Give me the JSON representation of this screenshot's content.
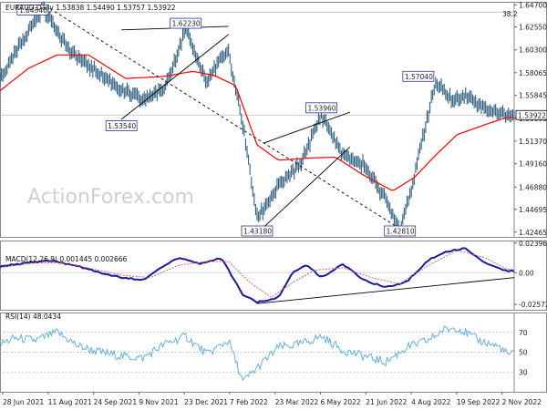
{
  "header": {
    "main": "EURAUD,Daily 1.53838 1.54490 1.53757 1.53922",
    "macd": "MACD(12,26,9) 0.001445 0.002666",
    "rsi": "RSI(14) 48.0434"
  },
  "watermark": "ActionForex.com",
  "fib_label": "38.2",
  "colors": {
    "price": "#2f5f80",
    "ma": "#ff0000",
    "macd": "#1a1a9a",
    "signal": "#e05050",
    "rsi": "#55aadd",
    "label_border": "#2b3a8f",
    "trendline": "#000000"
  },
  "chart_data": [
    {
      "type": "line",
      "title": "EURAUD,Daily",
      "ohlc_last": {
        "open": 1.53838,
        "high": 1.5449,
        "low": 1.53757,
        "close": 1.53922
      },
      "last_price_tag": "1.53922",
      "y_ticks": [
        "1.64700",
        "1.62550",
        "1.60300",
        "1.58065",
        "1.55845",
        "1.53595",
        "1.51370",
        "1.49160",
        "1.46880",
        "1.44695",
        "1.42465"
      ],
      "ylim": [
        1.42,
        1.65
      ],
      "x_ticks": [
        "28 Jun 2021",
        "11 Aug 2021",
        "24 Sep 2021",
        "9 Nov 2021",
        "23 Dec 2021",
        "7 Feb 2022",
        "23 Mar 2022",
        "6 May 2022",
        "21 Jun 2022",
        "4 Aug 2022",
        "19 Sep 2022",
        "2 Nov 2022"
      ],
      "x_domain": [
        0,
        360
      ],
      "series": [
        {
          "style": "close",
          "x": [
            0,
            10,
            20,
            30,
            40,
            50,
            62,
            75,
            88,
            100,
            115,
            130,
            145,
            152,
            160,
            170,
            180,
            195,
            210,
            225,
            240,
            255,
            268,
            280,
            290,
            298,
            305,
            318,
            325,
            340,
            355
          ],
          "y": [
            1.575,
            1.597,
            1.622,
            1.6434,
            1.622,
            1.6,
            1.588,
            1.575,
            1.561,
            1.554,
            1.565,
            1.6223,
            1.57,
            1.59,
            1.6,
            1.53,
            1.438,
            1.47,
            1.49,
            1.5396,
            1.5,
            1.49,
            1.462,
            1.4281,
            1.478,
            1.53,
            1.5704,
            1.552,
            1.559,
            1.545,
            1.53922
          ]
        },
        {
          "style": "moving-average",
          "x": [
            0,
            20,
            40,
            62,
            88,
            115,
            135,
            150,
            165,
            180,
            195,
            215,
            235,
            255,
            275,
            290,
            305,
            320,
            340,
            355
          ],
          "y": [
            1.563,
            1.585,
            1.598,
            1.598,
            1.575,
            1.577,
            1.582,
            1.578,
            1.568,
            1.51,
            1.495,
            1.497,
            1.498,
            1.48,
            1.465,
            1.478,
            1.5,
            1.52,
            1.53,
            1.537
          ]
        }
      ],
      "annotations": [
        {
          "text": "1.64340",
          "x": 35,
          "y": 1.6434
        },
        {
          "text": "1.62230",
          "x": 130,
          "y": 1.6223
        },
        {
          "text": "1.53540",
          "x": 85,
          "y": 1.5354
        },
        {
          "text": "1.43180",
          "x": 180,
          "y": 1.4318
        },
        {
          "text": "1.53960",
          "x": 225,
          "y": 1.5396
        },
        {
          "text": "1.42810",
          "x": 280,
          "y": 1.4281
        },
        {
          "text": "1.57040",
          "x": 305,
          "y": 1.5704
        }
      ],
      "trendlines": [
        {
          "style": "dashed",
          "x": [
            35,
            280
          ],
          "y": [
            1.6434,
            1.4281
          ]
        },
        {
          "style": "solid",
          "x": [
            85,
            160
          ],
          "y": [
            1.535,
            1.618
          ]
        },
        {
          "style": "solid",
          "x": [
            85,
            160
          ],
          "y": [
            1.6225,
            1.626
          ]
        },
        {
          "style": "solid",
          "x": [
            185,
            245
          ],
          "y": [
            1.43,
            1.508
          ]
        },
        {
          "style": "solid",
          "x": [
            185,
            245
          ],
          "y": [
            1.512,
            1.542
          ]
        },
        {
          "style": "fib",
          "x": [
            0,
            360
          ],
          "y": [
            1.64,
            1.64
          ]
        }
      ]
    },
    {
      "type": "line",
      "title": "MACD(12,26,9)",
      "values_label": [
        "0.001445",
        "0.002666"
      ],
      "y_ticks": [
        "0.023963",
        "0.00",
        "-0.025726"
      ],
      "ylim": [
        -0.03,
        0.026
      ],
      "series": [
        {
          "style": "macd",
          "x": [
            0,
            20,
            35,
            55,
            70,
            85,
            100,
            112,
            125,
            140,
            155,
            170,
            180,
            195,
            205,
            215,
            225,
            240,
            255,
            270,
            285,
            300,
            310,
            325,
            340,
            355
          ],
          "y": [
            0.005,
            0.008,
            0.01,
            0.005,
            0.0,
            -0.004,
            -0.006,
            0.004,
            0.012,
            0.007,
            0.012,
            -0.018,
            -0.024,
            -0.02,
            0.0,
            0.006,
            -0.004,
            0.007,
            -0.006,
            -0.012,
            -0.007,
            0.01,
            0.016,
            0.02,
            0.008,
            0.001445
          ]
        },
        {
          "style": "signal",
          "x": [
            0,
            25,
            45,
            65,
            85,
            105,
            125,
            145,
            160,
            175,
            190,
            205,
            220,
            240,
            260,
            280,
            300,
            320,
            340,
            355
          ],
          "y": [
            0.004,
            0.008,
            0.008,
            0.003,
            -0.002,
            -0.004,
            0.006,
            0.009,
            0.009,
            -0.008,
            -0.02,
            -0.008,
            0.002,
            0.004,
            -0.004,
            -0.009,
            0.006,
            0.018,
            0.012,
            0.002666
          ]
        }
      ],
      "trendlines": [
        {
          "style": "solid",
          "x": [
            180,
            360
          ],
          "y": [
            -0.025,
            -0.004
          ]
        }
      ]
    },
    {
      "type": "line",
      "title": "RSI(14)",
      "value_label": "48.0434",
      "y_ticks": [
        "70",
        "50",
        "30"
      ],
      "ylim": [
        10,
        90
      ],
      "series": [
        {
          "style": "rsi",
          "x": [
            0,
            10,
            25,
            40,
            55,
            70,
            85,
            100,
            115,
            130,
            145,
            160,
            170,
            180,
            195,
            210,
            225,
            240,
            255,
            270,
            285,
            300,
            310,
            320,
            335,
            350,
            355
          ],
          "y": [
            58,
            64,
            62,
            70,
            56,
            50,
            46,
            44,
            58,
            66,
            48,
            62,
            20,
            34,
            55,
            58,
            66,
            52,
            46,
            40,
            55,
            62,
            72,
            75,
            62,
            55,
            48
          ]
        }
      ]
    }
  ]
}
